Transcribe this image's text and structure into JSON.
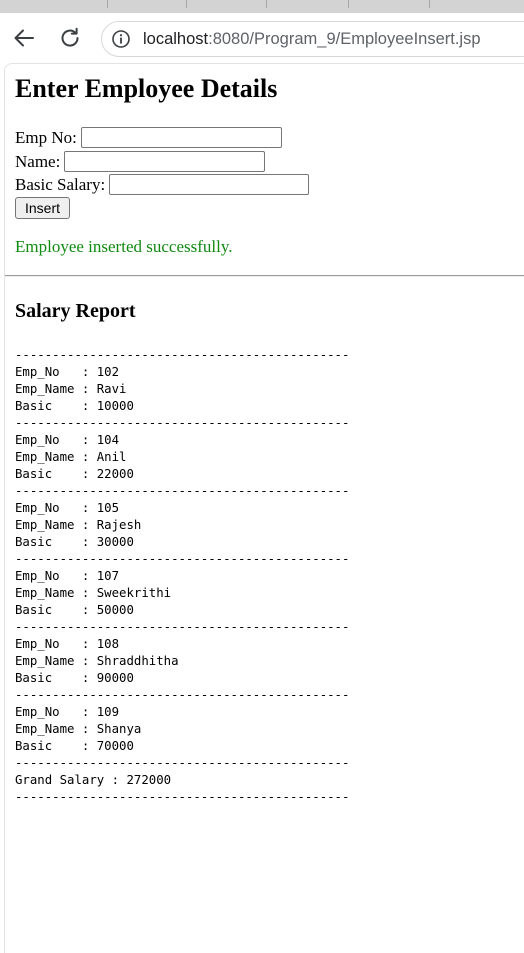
{
  "browser": {
    "url_host": "localhost",
    "url_path": ":8080/Program_9/EmployeeInsert.jsp",
    "icons": [
      "back-arrow-icon",
      "reload-icon",
      "site-info-icon"
    ]
  },
  "page": {
    "title": "Enter Employee Details",
    "form": {
      "empno_label": "Emp No:",
      "empno_value": "",
      "name_label": "Name:",
      "name_value": "",
      "salary_label": "Basic Salary:",
      "salary_value": "",
      "insert_label": "Insert"
    },
    "status_message": "Employee inserted successfully.",
    "status_color": "#118a11",
    "report_title": "Salary Report",
    "report": {
      "separator": "---------------------------------------------",
      "labels": {
        "empno": "Emp_No   : ",
        "name": "Emp_Name : ",
        "basic": "Basic    : "
      },
      "employees": [
        {
          "emp_no": "102",
          "emp_name": "Ravi",
          "basic": "10000"
        },
        {
          "emp_no": "104",
          "emp_name": "Anil",
          "basic": "22000"
        },
        {
          "emp_no": "105",
          "emp_name": "Rajesh",
          "basic": "30000"
        },
        {
          "emp_no": "107",
          "emp_name": "Sweekrithi",
          "basic": "50000"
        },
        {
          "emp_no": "108",
          "emp_name": "Shraddhitha",
          "basic": "90000"
        },
        {
          "emp_no": "109",
          "emp_name": "Shanya",
          "basic": "70000"
        }
      ],
      "grand_label": "Grand Salary : ",
      "grand_total": "272000"
    }
  }
}
